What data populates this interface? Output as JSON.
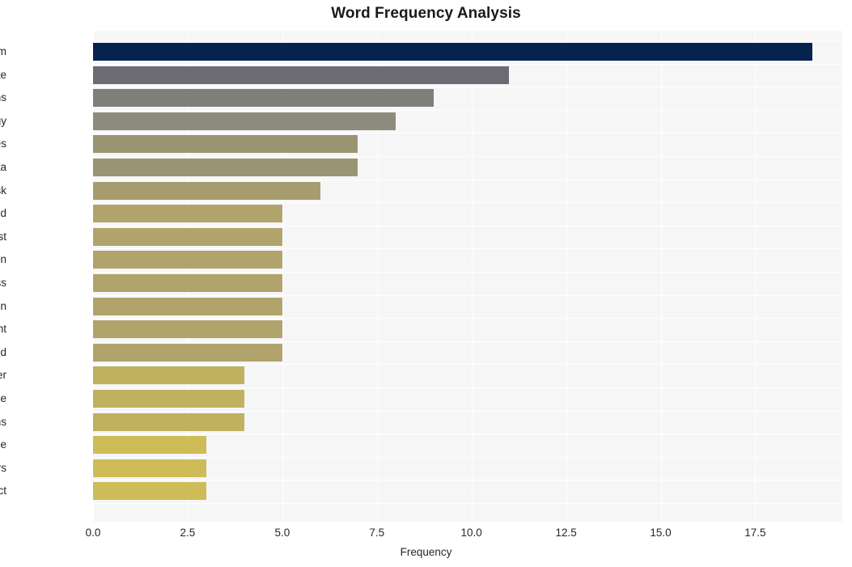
{
  "chart_data": {
    "type": "bar",
    "orientation": "horizontal",
    "title": "Word Frequency Analysis",
    "xlabel": "Frequency",
    "ylabel": "",
    "categories": [
      "quantum",
      "compute",
      "organizations",
      "technology",
      "businesses",
      "data",
      "risk",
      "need",
      "exist",
      "encryption",
      "process",
      "innovation",
      "important",
      "understand",
      "consider",
      "pace",
      "applications",
      "pose",
      "computers",
      "predict"
    ],
    "values": [
      19,
      11,
      9,
      8,
      7,
      7,
      6,
      5,
      5,
      5,
      5,
      5,
      5,
      5,
      4,
      4,
      4,
      3,
      3,
      3
    ],
    "xlim": [
      0,
      19.8
    ],
    "xticks": [
      0.0,
      2.5,
      5.0,
      7.5,
      10.0,
      12.5,
      15.0,
      17.5
    ],
    "xticklabels": [
      "0.0",
      "2.5",
      "5.0",
      "7.5",
      "10.0",
      "12.5",
      "15.0",
      "17.5"
    ],
    "grid": true,
    "legend": "none",
    "bar_colors": [
      "#04234f",
      "#6b6b73",
      "#7f7e79",
      "#8d8b7c",
      "#9b9472",
      "#9b9472",
      "#a79c6e",
      "#b0a46c",
      "#b0a46c",
      "#b0a46c",
      "#b0a46c",
      "#b0a46c",
      "#b0a46c",
      "#b0a46c",
      "#bfb160",
      "#bfb160",
      "#bfb160",
      "#cdbc57",
      "#cdbc57",
      "#cdbc57"
    ],
    "plot_background": "#f6f6f7",
    "gridline_color": "#ffffff",
    "text_color": "#262626",
    "figure_background": "#ffffff"
  }
}
